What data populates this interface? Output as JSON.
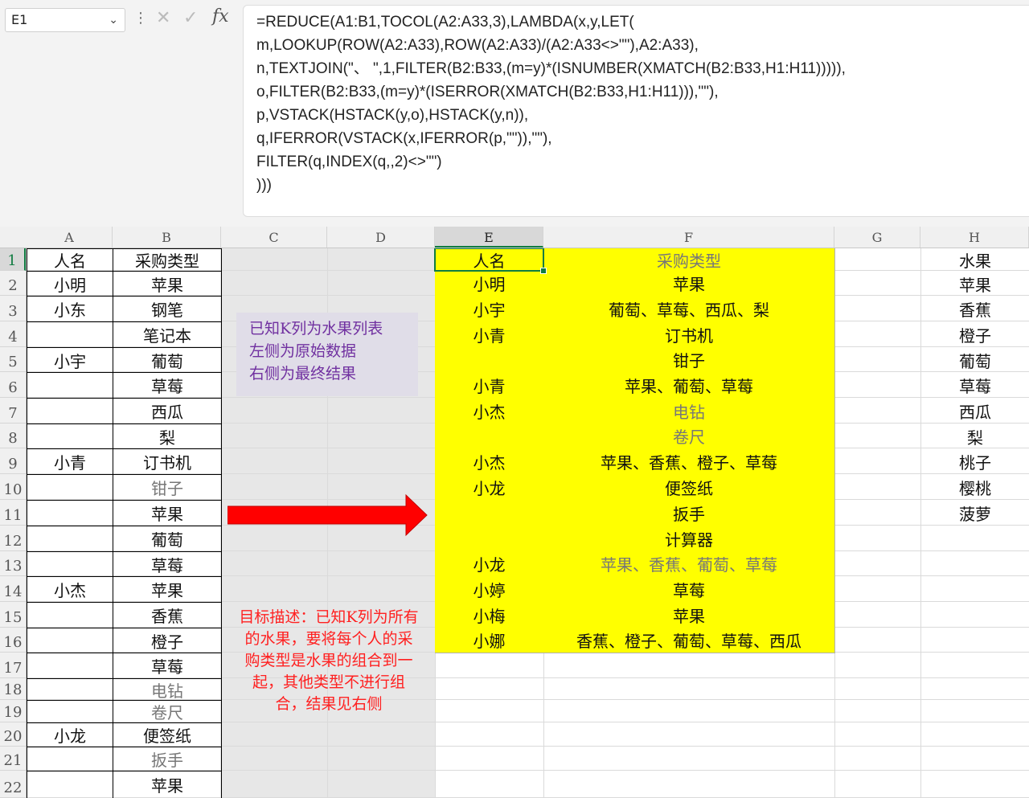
{
  "name_box": "E1",
  "formula_lines": [
    "=REDUCE(A1:B1,TOCOL(A2:A33,3),LAMBDA(x,y,LET(",
    "m,LOOKUP(ROW(A2:A33),ROW(A2:A33)/(A2:A33<>\"\"),A2:A33),",
    "n,TEXTJOIN(\"、 \",1,FILTER(B2:B33,(m=y)*(ISNUMBER(XMATCH(B2:B33,H1:H11))))),",
    "o,FILTER(B2:B33,(m=y)*(ISERROR(XMATCH(B2:B33,H1:H11))),\"\"),",
    "p,VSTACK(HSTACK(y,o),HSTACK(y,n)),",
    "q,IFERROR(VSTACK(x,IFERROR(p,\"\")),\"\"),",
    "FILTER(q,INDEX(q,,2)<>\"\")",
    ")))"
  ],
  "columns": [
    "A",
    "B",
    "C",
    "D",
    "E",
    "F",
    "G",
    "H"
  ],
  "rows": [
    "1",
    "2",
    "3",
    "4",
    "5",
    "6",
    "7",
    "8",
    "9",
    "10",
    "11",
    "12",
    "13",
    "14",
    "15",
    "16",
    "17",
    "18",
    "19",
    "20",
    "21",
    "22"
  ],
  "source_table": [
    [
      "人名",
      "采购类型"
    ],
    [
      "小明",
      "苹果"
    ],
    [
      "小东",
      "钢笔"
    ],
    [
      "",
      "笔记本"
    ],
    [
      "小宇",
      "葡萄"
    ],
    [
      "",
      "草莓"
    ],
    [
      "",
      "西瓜"
    ],
    [
      "",
      "梨"
    ],
    [
      "小青",
      "订书机"
    ],
    [
      "",
      "钳子"
    ],
    [
      "",
      "苹果"
    ],
    [
      "",
      "葡萄"
    ],
    [
      "",
      "草莓"
    ],
    [
      "小杰",
      "苹果"
    ],
    [
      "",
      "香蕉"
    ],
    [
      "",
      "橙子"
    ],
    [
      "",
      "草莓"
    ],
    [
      "",
      "电钻"
    ],
    [
      "",
      "卷尺"
    ],
    [
      "小龙",
      "便签纸"
    ],
    [
      "",
      "扳手"
    ],
    [
      "",
      "苹果"
    ]
  ],
  "result_table": [
    [
      "人名",
      "采购类型"
    ],
    [
      "小明",
      "苹果"
    ],
    [
      "小宇",
      "葡萄、草莓、西瓜、梨"
    ],
    [
      "小青",
      "订书机"
    ],
    [
      "",
      "钳子"
    ],
    [
      "小青",
      "苹果、葡萄、草莓"
    ],
    [
      "小杰",
      "电钻"
    ],
    [
      "",
      "卷尺"
    ],
    [
      "小杰",
      "苹果、香蕉、橙子、草莓"
    ],
    [
      "小龙",
      "便签纸"
    ],
    [
      "",
      "扳手"
    ],
    [
      "",
      "计算器"
    ],
    [
      "小龙",
      "苹果、香蕉、葡萄、草莓"
    ],
    [
      "小婷",
      "草莓"
    ],
    [
      "小梅",
      "苹果"
    ],
    [
      "小娜",
      "香蕉、橙子、葡萄、草莓、西瓜"
    ]
  ],
  "fruit_list": [
    "水果",
    "苹果",
    "香蕉",
    "橙子",
    "葡萄",
    "草莓",
    "西瓜",
    "梨",
    "桃子",
    "樱桃",
    "菠萝"
  ],
  "note_top": [
    "已知K列为水果列表",
    "左侧为原始数据",
    "右侧为最终结果"
  ],
  "note_bottom": [
    "目标描述：已知K列为所有",
    "的水果，要将每个人的采",
    "购类型是水果的组合到一",
    "起，其他类型不进行组",
    "合，结果见右侧"
  ],
  "colors": {
    "highlight": "#ffff00",
    "arrow": "#ff0000",
    "note_top_text": "#7030a0",
    "note_bottom_text": "#ff2020",
    "selection": "#107c41"
  }
}
